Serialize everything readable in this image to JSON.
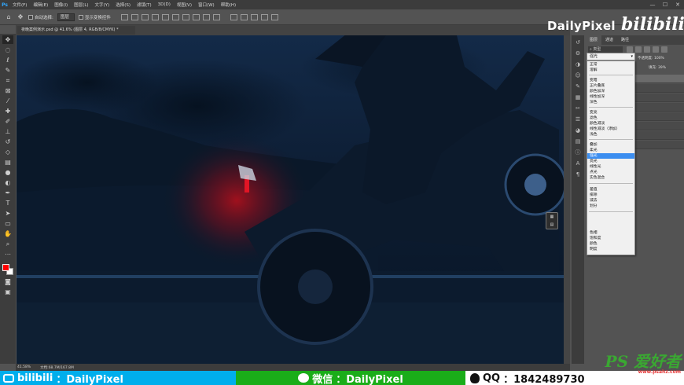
{
  "menubar": {
    "app_icon": "Ps",
    "items": [
      "文件(F)",
      "编辑(E)",
      "图像(I)",
      "图层(L)",
      "文字(Y)",
      "选择(S)",
      "滤镜(T)",
      "3D(D)",
      "视图(V)",
      "窗口(W)",
      "帮助(H)"
    ],
    "window_controls": [
      "—",
      "☐",
      "✕"
    ]
  },
  "options": {
    "auto_select_label": "自动选择:",
    "auto_select_value": "图层",
    "transform_label": "显示变换控件"
  },
  "document": {
    "tab_label": "夜晚案例演示.psd @ 41.6% (图层 4, RGB/8/CMYK) *",
    "zoom": "41.58%",
    "doc_info": "文档:68.7M/167.8M"
  },
  "layers_panel": {
    "tabs": [
      "图层",
      "通道",
      "路径"
    ],
    "search_kind": "类型",
    "opacity_label": "不透明度:",
    "opacity_value": "100%",
    "fill_label": "填充:",
    "fill_value": "39%"
  },
  "blend_mode": {
    "current": "强光",
    "groups": [
      [
        "正常",
        "溶解"
      ],
      [
        "变暗",
        "正片叠底",
        "颜色加深",
        "线性加深",
        "深色"
      ],
      [
        "变亮",
        "滤色",
        "颜色减淡",
        "线性减淡（添加）",
        "浅色"
      ],
      [
        "叠加",
        "柔光",
        "强光",
        "亮光",
        "线性光",
        "点光",
        "实色混合"
      ],
      [
        "差值",
        "排除",
        "减去",
        "划分"
      ],
      [
        "色相",
        "饱和度",
        "颜色",
        "明度"
      ]
    ],
    "highlighted": "强光"
  },
  "watermark": {
    "channel": "DailyPixel",
    "platform": "bilibili"
  },
  "banner": {
    "bili_text": "bilibili",
    "bili_account": "：DailyPixel",
    "wechat_label": "微信",
    "wechat_account": "：DailyPixel",
    "qq_label": "QQ",
    "qq_number": "：1842489730",
    "site_logo": "PS 爱好者",
    "site_url": "www.psahz.com"
  },
  "colors": {
    "foreground": "#ff0000",
    "background": "#ffffff",
    "bili_blue": "#00aeec",
    "wechat_green": "#1aad19",
    "highlight": "#3c8ef0"
  }
}
